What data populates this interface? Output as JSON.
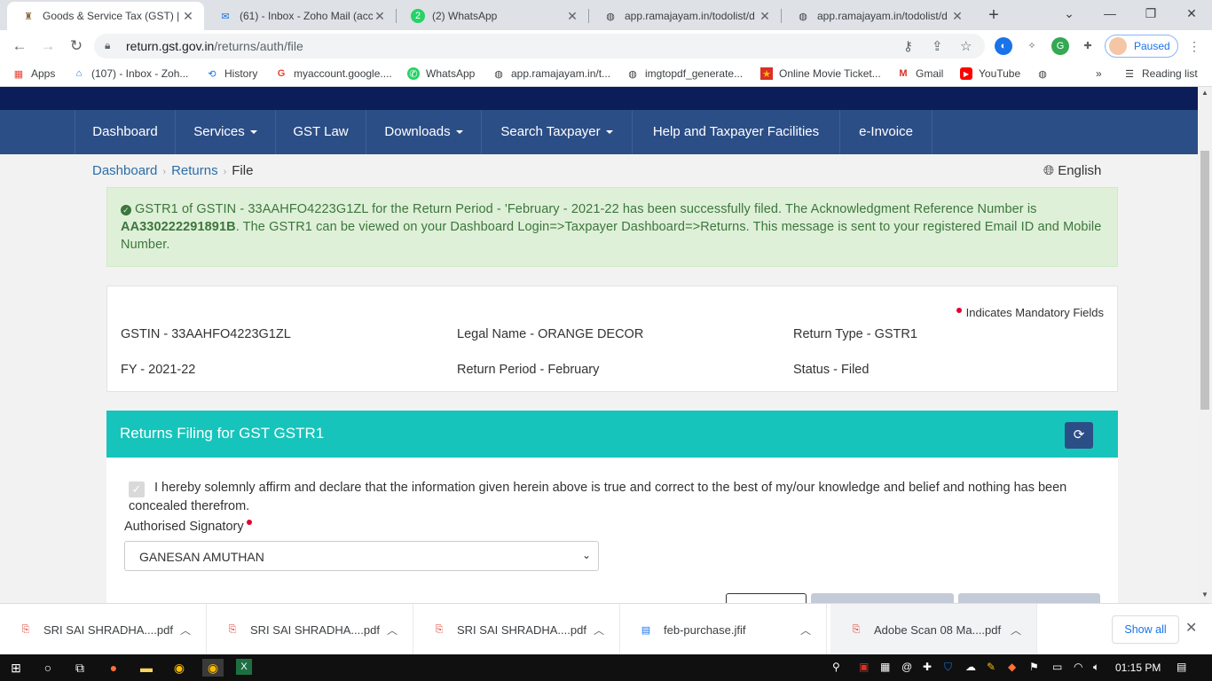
{
  "browser": {
    "tabs": [
      {
        "title": "Goods & Service Tax (GST) | U",
        "icon": "gst-emblem-icon",
        "active": true
      },
      {
        "title": "(61) - Inbox - Zoho Mail (acc",
        "icon": "zoho-mail-icon",
        "active": false
      },
      {
        "title": "(2) WhatsApp",
        "icon": "whatsapp-icon",
        "badge": "2",
        "active": false
      },
      {
        "title": "app.ramajayam.in/todolist/d",
        "icon": "globe-icon",
        "active": false
      },
      {
        "title": "app.ramajayam.in/todolist/d",
        "icon": "globe-icon",
        "active": false
      }
    ],
    "url_host": "return.gst.gov.in",
    "url_path": "/returns/auth/file",
    "profile_status": "Paused",
    "bookmarks": [
      {
        "label": "Apps",
        "icon": "apps-grid-icon"
      },
      {
        "label": "(107) - Inbox - Zoh...",
        "icon": "zoho-mail-icon"
      },
      {
        "label": "History",
        "icon": "history-icon"
      },
      {
        "label": "myaccount.google....",
        "icon": "google-icon"
      },
      {
        "label": "WhatsApp",
        "icon": "whatsapp-icon"
      },
      {
        "label": "app.ramajayam.in/t...",
        "icon": "globe-icon"
      },
      {
        "label": "imgtopdf_generate...",
        "icon": "globe-icon"
      },
      {
        "label": "Online Movie Ticket...",
        "icon": "movie-ticket-icon"
      },
      {
        "label": "Gmail",
        "icon": "gmail-icon"
      },
      {
        "label": "YouTube",
        "icon": "youtube-icon"
      }
    ],
    "overflow_label": "»",
    "reading_list": "Reading list"
  },
  "nav": {
    "items": [
      "Dashboard",
      "Services",
      "GST Law",
      "Downloads",
      "Search Taxpayer",
      "Help and Taxpayer Facilities",
      "e-Invoice"
    ]
  },
  "breadcrumb": {
    "dashboard": "Dashboard",
    "returns": "Returns",
    "current": "File"
  },
  "language": "English",
  "alert": {
    "text1": "GSTR1 of GSTIN - 33AAHFO4223G1ZL for the Return Period - 'February - 2021-22 has been successfully filed. The Acknowledgment Reference Number is ",
    "arn": "AA330222291891B",
    "text2": ". The GSTR1 can be viewed on your Dashboard Login=>Taxpayer Dashboard=>Returns. This message is sent to your registered Email ID and Mobile Number."
  },
  "info": {
    "mandatory_note": "Indicates Mandatory Fields",
    "gstin": "GSTIN - 33AAHFO4223G1ZL",
    "legal_name": "Legal Name - ORANGE DECOR",
    "return_type": "Return Type - GSTR1",
    "fy": "FY - 2021-22",
    "return_period": "Return Period - February",
    "status": "Status - Filed"
  },
  "panel": {
    "title": "Returns Filing for GST GSTR1",
    "declaration": "I hereby solemnly affirm and declare that the information given herein above is true and correct to the best of my/our knowledge and belief and nothing has been concealed therefrom.",
    "signatory_label": "Authorised Signatory",
    "signatory_value": "GANESAN AMUTHAN"
  },
  "downloads": [
    {
      "name": "SRI SAI SHRADHA....pdf",
      "icon": "pdf-icon"
    },
    {
      "name": "SRI SAI SHRADHA....pdf",
      "icon": "pdf-icon"
    },
    {
      "name": "SRI SAI SHRADHA....pdf",
      "icon": "pdf-icon"
    },
    {
      "name": "feb-purchase.jfif",
      "icon": "image-file-icon"
    },
    {
      "name": "Adobe Scan 08 Ma....pdf",
      "icon": "pdf-icon"
    }
  ],
  "show_all": "Show all",
  "taskbar": {
    "time": "01:15 PM"
  },
  "colors": {
    "nav": "#2c4e86",
    "topbar": "#0b1e59",
    "panel": "#17c4bb",
    "alert_bg": "#dff0d8",
    "alert_text": "#3c763d"
  }
}
